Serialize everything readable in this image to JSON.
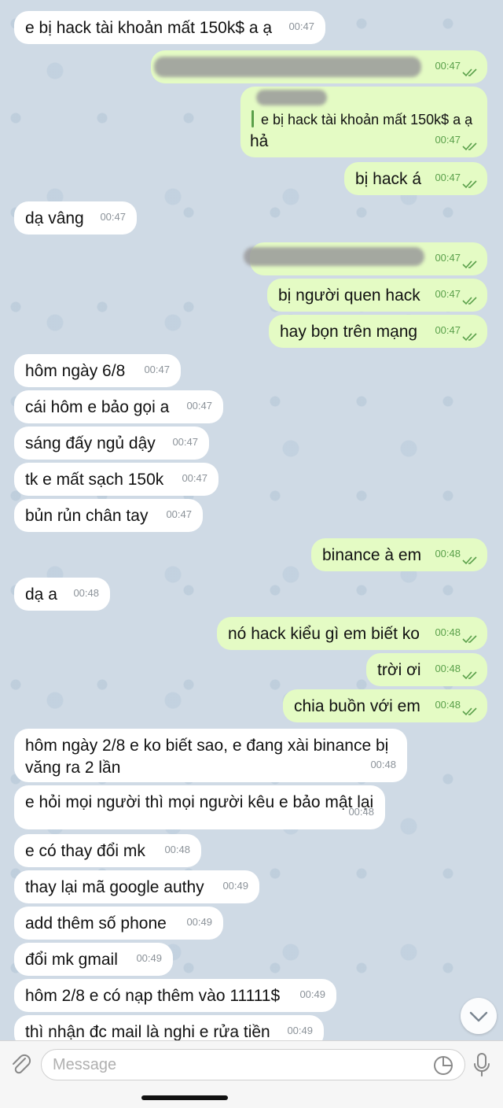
{
  "messages": [
    {
      "text": "e bị hack tài khoản mất 150k$ a ạ",
      "time": "00:47"
    },
    {
      "text": "",
      "time": "00:47"
    },
    {
      "reply_quote": "e bị hack tài khoản mất 150k$ a ạ",
      "text": "hả",
      "time": "00:47"
    },
    {
      "text": "bị hack á",
      "time": "00:47"
    },
    {
      "text": "dạ vâng",
      "time": "00:47"
    },
    {
      "text": "",
      "time": "00:47"
    },
    {
      "text": "bị người quen hack",
      "time": "00:47"
    },
    {
      "text": "hay bọn trên mạng",
      "time": "00:47"
    },
    {
      "text": "hôm ngày 6/8",
      "time": "00:47"
    },
    {
      "text": "cái hôm e bảo gọi a",
      "time": "00:47"
    },
    {
      "text": "sáng đấy ngủ dậy",
      "time": "00:47"
    },
    {
      "text": "tk e mất sạch 150k",
      "time": "00:47"
    },
    {
      "text": "bủn rủn chân tay",
      "time": "00:47"
    },
    {
      "text": "binance à em",
      "time": "00:48"
    },
    {
      "text": "dạ a",
      "time": "00:48"
    },
    {
      "text": "nó hack kiểu gì em biết ko",
      "time": "00:48"
    },
    {
      "text": "trời ơi",
      "time": "00:48"
    },
    {
      "text": "chia buồn với em",
      "time": "00:48"
    },
    {
      "line1": "hôm ngày 2/8 e ko biết sao, e đang xài binance bị",
      "line2": "văng ra 2 lần",
      "time": "00:48"
    },
    {
      "text": "e hỏi mọi người thì mọi người kêu e bảo mật lại",
      "time": "00:48"
    },
    {
      "text": "e có thay đổi mk",
      "time": "00:48"
    },
    {
      "text": "thay lại mã google authy",
      "time": "00:49"
    },
    {
      "text": "add thêm số phone",
      "time": "00:49"
    },
    {
      "text": "đổi mk gmail",
      "time": "00:49"
    },
    {
      "text": "hôm 2/8 e có nạp thêm vào 11111$",
      "time": "00:49"
    },
    {
      "text": "thì nhận đc mail là nghi e rửa tiền",
      "time": "00:49"
    }
  ],
  "input": {
    "placeholder": "Message"
  },
  "icons": {
    "attach": "paperclip-icon",
    "sticker": "sticker-icon",
    "mic": "microphone-icon",
    "scroll": "chevron-down-icon"
  },
  "colors": {
    "incoming": "#ffffff",
    "outgoing": "#e4fbc4",
    "ticks": "#5aa04a"
  }
}
